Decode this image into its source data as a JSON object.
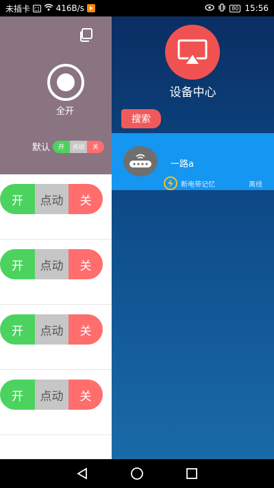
{
  "status_bar": {
    "carrier": "未插卡",
    "sim_badge": "□",
    "speed": "416B/s",
    "battery": "80",
    "time": "15:56"
  },
  "left_panel": {
    "all_on_label": "全开",
    "default_label": "默认",
    "default_switch": {
      "on": "开",
      "pulse": "点动",
      "off": "关"
    },
    "channels": [
      {
        "on": "开",
        "pulse": "点动",
        "off": "关"
      },
      {
        "on": "开",
        "pulse": "点动",
        "off": "关"
      },
      {
        "on": "开",
        "pulse": "点动",
        "off": "关"
      },
      {
        "on": "开",
        "pulse": "点动",
        "off": "关"
      }
    ]
  },
  "right_panel": {
    "title": "设备中心",
    "search_button": "搜索",
    "device": {
      "name": "一路a",
      "memory_label": "断电带记忆",
      "status": "离线"
    }
  },
  "colors": {
    "on": "#4cd35f",
    "pulse": "#c6c6c6",
    "off": "#ff6d6d",
    "accent_red": "#f05252",
    "device_bg": "#1596f0"
  }
}
